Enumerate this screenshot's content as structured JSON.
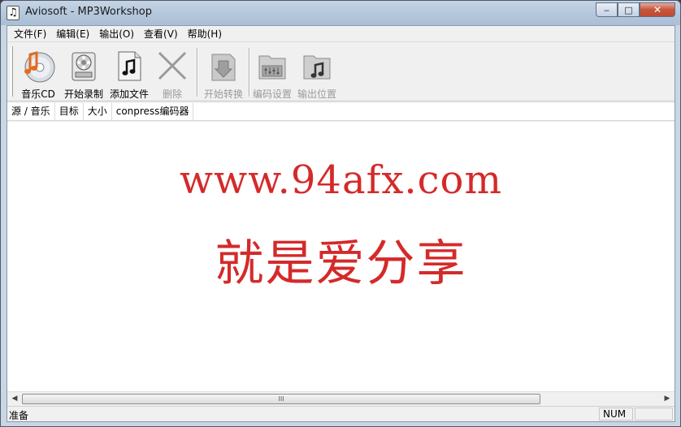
{
  "window": {
    "title": "Aviosoft - MP3Workshop",
    "app_icon": "music-note-icon",
    "caption_buttons": {
      "minimize": "‒",
      "maximize": "□",
      "close": "✕"
    }
  },
  "menu": [
    {
      "label": "文件(F)"
    },
    {
      "label": "编辑(E)"
    },
    {
      "label": "输出(O)"
    },
    {
      "label": "查看(V)"
    },
    {
      "label": "帮助(H)"
    }
  ],
  "toolbar": {
    "buttons": [
      {
        "label": "音乐CD",
        "icon": "music-cd-icon",
        "enabled": true
      },
      {
        "label": "开始录制",
        "icon": "film-reel-icon",
        "enabled": true
      },
      {
        "label": "添加文件",
        "icon": "music-file-icon",
        "enabled": true
      },
      {
        "label": "删除",
        "icon": "delete-x-icon",
        "enabled": false
      },
      {
        "label": "开始转换",
        "icon": "convert-icon",
        "enabled": false
      },
      {
        "label": "编码设置",
        "icon": "encoder-settings-icon",
        "enabled": false
      },
      {
        "label": "输出位置",
        "icon": "output-folder-icon",
        "enabled": false
      }
    ]
  },
  "list": {
    "columns": [
      "源 / 音乐",
      "目标",
      "大小",
      "conpress编码器"
    ]
  },
  "watermark": {
    "url": "www.94afx.com",
    "slogan": "就是爱分享"
  },
  "scrollbar": {
    "grip": "III",
    "left_arrow": "◀",
    "right_arrow": "▶"
  },
  "status": {
    "text": "准备",
    "num": "NUM"
  },
  "colors": {
    "watermark": "#d42a2a",
    "close_button": "#c7553c"
  }
}
